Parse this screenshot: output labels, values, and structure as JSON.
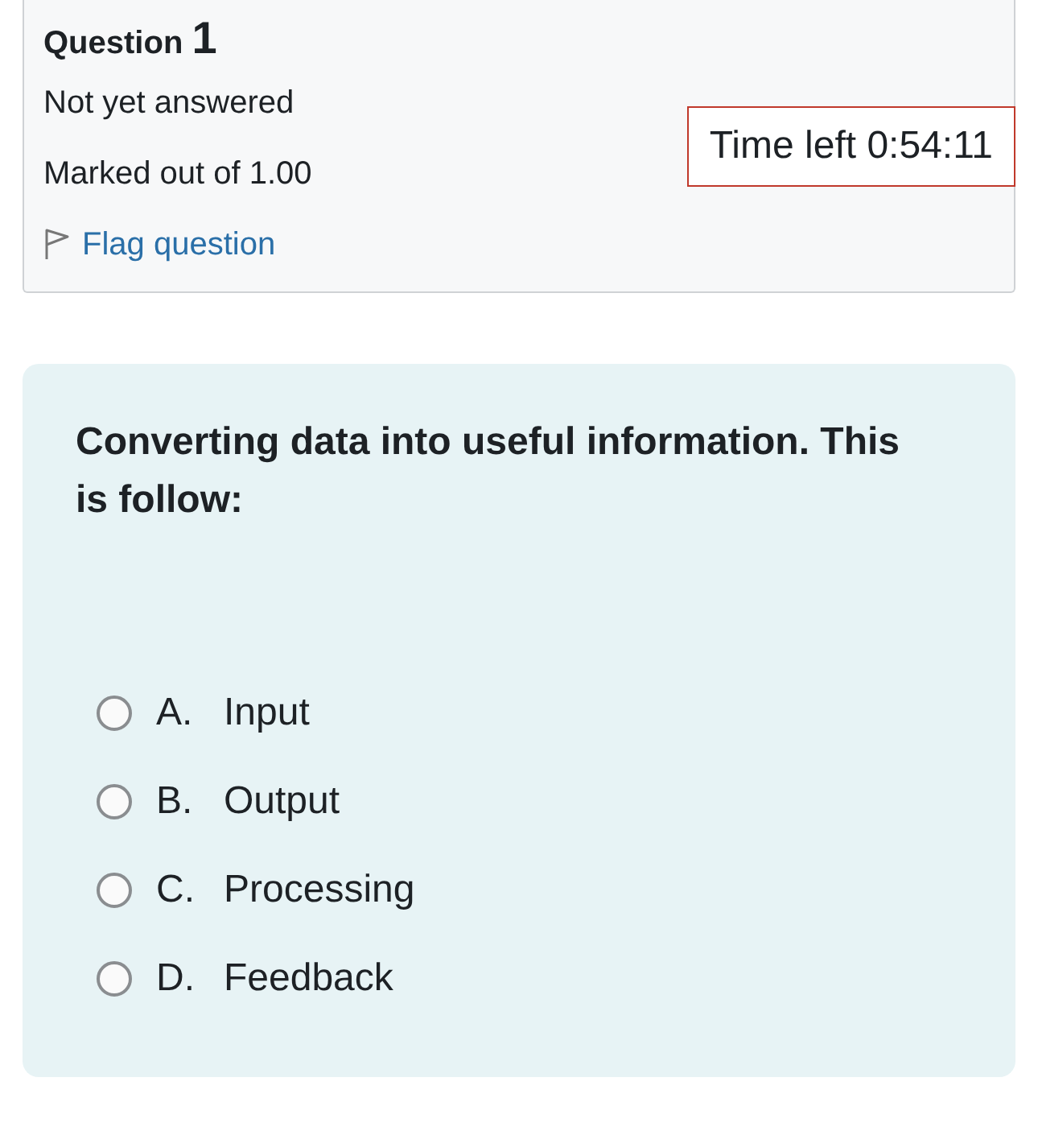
{
  "question_info": {
    "label": "Question",
    "number": "1",
    "status": "Not yet answered",
    "marks": "Marked out of 1.00",
    "flag": {
      "label": "Flag question",
      "flagged": false
    }
  },
  "timer": {
    "label": "Time left 0:54:11"
  },
  "question": {
    "text": "Converting data into useful information. This is follow:",
    "options": [
      {
        "letter": "A.",
        "label": "Input",
        "selected": false
      },
      {
        "letter": "B.",
        "label": "Output",
        "selected": false
      },
      {
        "letter": "C.",
        "label": "Processing",
        "selected": false
      },
      {
        "letter": "D.",
        "label": "Feedback",
        "selected": false
      }
    ]
  }
}
